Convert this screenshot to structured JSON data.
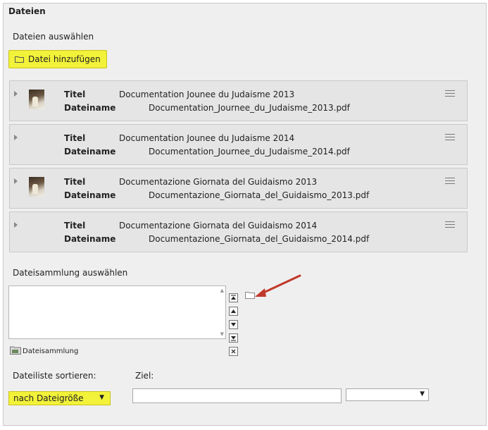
{
  "section": {
    "title": "Dateien",
    "select_files_label": "Dateien auswählen",
    "add_button_label": "Datei hinzufügen"
  },
  "files": [
    {
      "title_key": "Titel",
      "title_value": "Documentation Jounee du Judaisme 2013",
      "filename_key": "Dateiname",
      "filename_value": "Documentation_Journee_du_Judaisme_2013.pdf",
      "has_thumb": true
    },
    {
      "title_key": "Titel",
      "title_value": "Documentation Jounee du Judaisme 2014",
      "filename_key": "Dateiname",
      "filename_value": "Documentation_Journee_du_Judaisme_2014.pdf",
      "has_thumb": false
    },
    {
      "title_key": "Titel",
      "title_value": "Documentazione Giornata del Guidaismo 2013",
      "filename_key": "Dateiname",
      "filename_value": "Documentazione_Giornata_del_Guidaismo_2013.pdf",
      "has_thumb": true
    },
    {
      "title_key": "Titel",
      "title_value": "Documentazione Giornata del Guidaismo 2014",
      "filename_key": "Dateiname",
      "filename_value": "Documentazione_Giornata_del_Guidaismo_2014.pdf",
      "has_thumb": false
    }
  ],
  "collection": {
    "label": "Dateisammlung auswählen",
    "link_label": "Dateisammlung",
    "controls": [
      "move-top",
      "move-up",
      "move-down",
      "move-bottom",
      "remove"
    ]
  },
  "sort": {
    "label": "Dateiliste sortieren:",
    "selected": "nach Dateigröße",
    "target_label": "Ziel:",
    "target_value": "",
    "target_select": ""
  },
  "colors": {
    "highlight": "#f2f23a",
    "arrow": "#c0392b"
  }
}
